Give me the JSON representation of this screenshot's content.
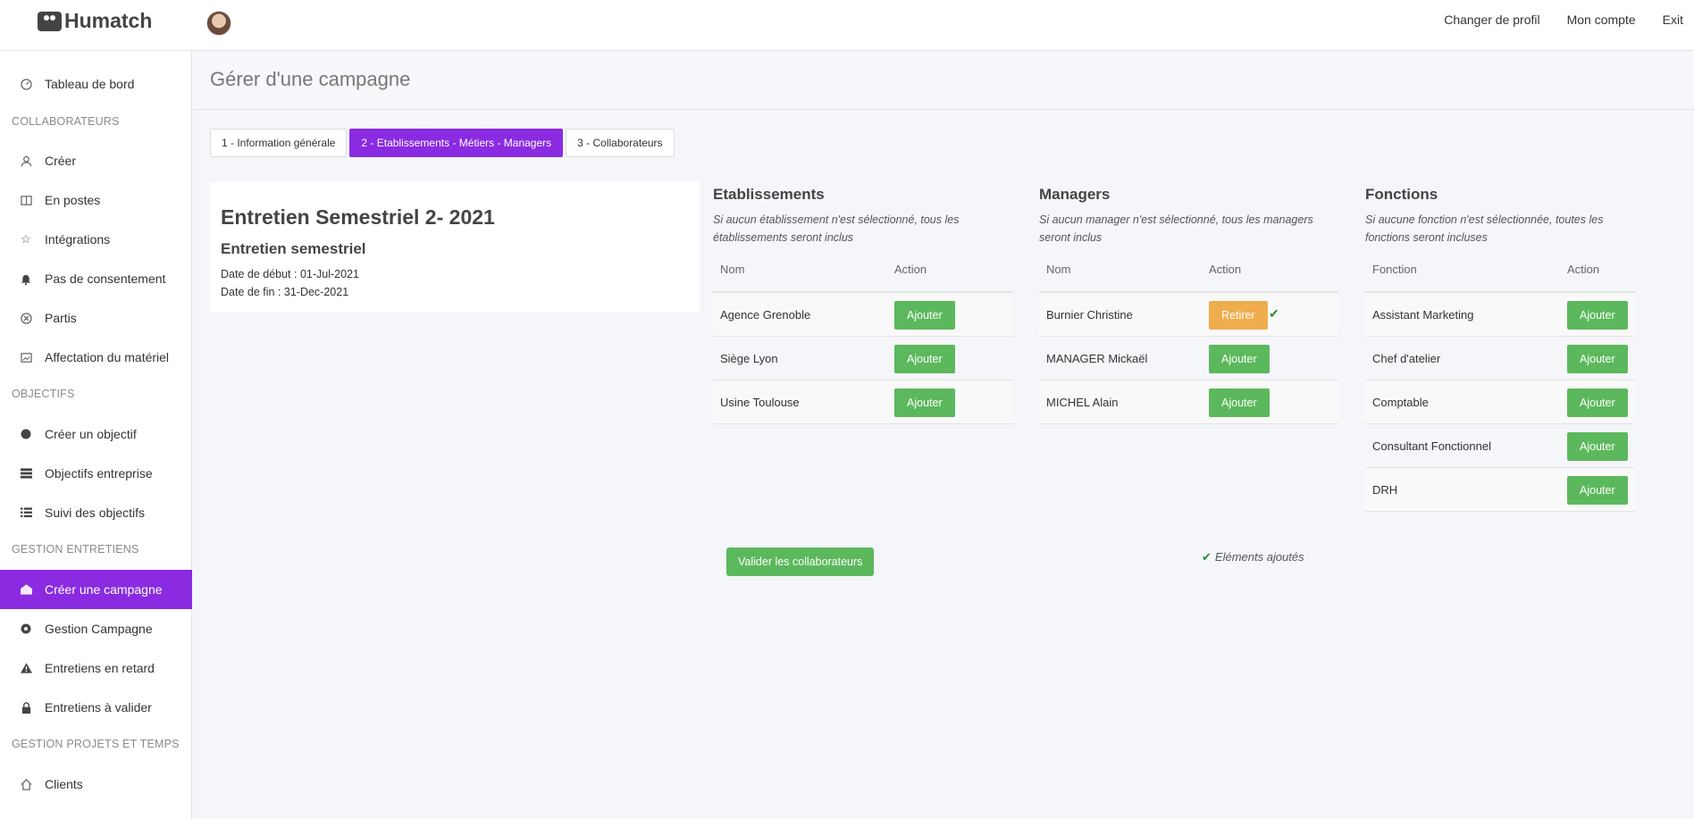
{
  "app": {
    "name": "Humatch"
  },
  "topnav": {
    "links": [
      "Changer de profil",
      "Mon compte",
      "Exit"
    ]
  },
  "sidebar": {
    "items": [
      {
        "label": "Tableau de bord",
        "icon": "gauge-icon"
      },
      {
        "section": "COLLABORATEURS"
      },
      {
        "label": "Créer",
        "icon": "user-icon"
      },
      {
        "label": "En postes",
        "icon": "book-icon"
      },
      {
        "label": "Intégrations",
        "icon": "star-icon"
      },
      {
        "label": "Pas de consentement",
        "icon": "bell-icon"
      },
      {
        "label": "Partis",
        "icon": "close-circle-icon"
      },
      {
        "label": "Affectation du matériel",
        "icon": "image-frame-icon"
      },
      {
        "section": "OBJECTIFS"
      },
      {
        "label": "Créer un objectif",
        "icon": "circle-icon"
      },
      {
        "label": "Objectifs entreprise",
        "icon": "list-box-icon"
      },
      {
        "label": "Suivi des objectifs",
        "icon": "list-icon"
      },
      {
        "section": "GESTION ENTRETIENS"
      },
      {
        "label": "Créer une campagne",
        "icon": "envelope-open-icon",
        "active": true
      },
      {
        "label": "Gestion Campagne",
        "icon": "cog-circle-icon"
      },
      {
        "label": "Entretiens en retard",
        "icon": "warning-icon"
      },
      {
        "label": "Entretiens à valider",
        "icon": "lock-icon"
      },
      {
        "section": "GESTION PROJETS ET TEMPS"
      },
      {
        "label": "Clients",
        "icon": "home-icon"
      }
    ]
  },
  "page": {
    "title": "Gérer d'une campagne"
  },
  "tabs": [
    {
      "label": "1 - Information générale",
      "active": false
    },
    {
      "label": "2 - Etablissements - Métiers - Managers",
      "active": true
    },
    {
      "label": "3 - Collaborateurs",
      "active": false
    }
  ],
  "campaign": {
    "title": "Entretien Semestriel 2- 2021",
    "subtitle": "Entretien semestriel",
    "start": "Date de début : 01-Jul-2021",
    "end": "Date de fin : 31-Dec-2021"
  },
  "etablissements": {
    "title": "Etablissements",
    "note": "Si aucun établissement n'est sélectionné, tous les établissements seront inclus",
    "headers": [
      "Nom",
      "Action"
    ],
    "rows": [
      {
        "name": "Agence Grenoble",
        "action": "Ajouter"
      },
      {
        "name": "Siège Lyon",
        "action": "Ajouter"
      },
      {
        "name": "Usine Toulouse",
        "action": "Ajouter"
      }
    ]
  },
  "managers": {
    "title": "Managers",
    "note": "Si aucun manager n'est sélectionné, tous les managers seront inclus",
    "headers": [
      "Nom",
      "Action"
    ],
    "rows": [
      {
        "name": "Burnier Christine",
        "action": "Retirer",
        "added": true
      },
      {
        "name": "MANAGER Mickaël",
        "action": "Ajouter"
      },
      {
        "name": "MICHEL Alain",
        "action": "Ajouter"
      }
    ]
  },
  "fonctions": {
    "title": "Fonctions",
    "note": "Si aucune fonction n'est sélectionnée, toutes les fonctions seront incluses",
    "headers": [
      "Fonction",
      "Action"
    ],
    "rows": [
      {
        "name": "Assistant Marketing",
        "action": "Ajouter"
      },
      {
        "name": "Chef d'atelier",
        "action": "Ajouter"
      },
      {
        "name": "Comptable",
        "action": "Ajouter"
      },
      {
        "name": "Consultant Fonctionnel",
        "action": "Ajouter"
      },
      {
        "name": "DRH",
        "action": "Ajouter"
      }
    ]
  },
  "footer": {
    "validate_label": "Valider les collaborateurs",
    "added_note": "Eléments ajoutés"
  },
  "colors": {
    "accent": "#8a2be2",
    "success": "#5cb85c",
    "warning": "#f0ad4e"
  }
}
